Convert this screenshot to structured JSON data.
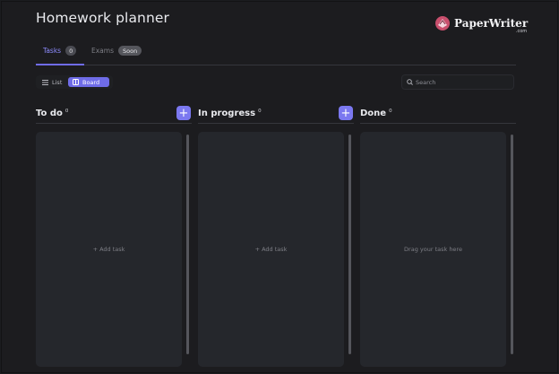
{
  "page": {
    "title": "Homework planner"
  },
  "brand": {
    "name": "PaperWriter",
    "domain": ".com",
    "accent": "#c94f6d"
  },
  "tabs": [
    {
      "label": "Tasks",
      "badge": "0",
      "active": true
    },
    {
      "label": "Exams",
      "badge": "Soon",
      "active": false
    }
  ],
  "view_toggle": {
    "list_label": "List",
    "board_label": "Board",
    "selected": "Board"
  },
  "search": {
    "placeholder": "Search",
    "value": ""
  },
  "columns": [
    {
      "title": "To do",
      "count": "0",
      "placeholder": "+ Add task"
    },
    {
      "title": "In progress",
      "count": "0",
      "placeholder": "+ Add task"
    },
    {
      "title": "Done",
      "count": "0",
      "placeholder": "Drag your task here"
    }
  ],
  "colors": {
    "accent": "#6f6ce8",
    "add_button": "#7b78f0",
    "background": "#1c1c1f",
    "column": "#25272c"
  },
  "icons": {
    "list": "list-icon",
    "board": "board-icon",
    "search": "search-icon",
    "add": "plus-icon"
  }
}
